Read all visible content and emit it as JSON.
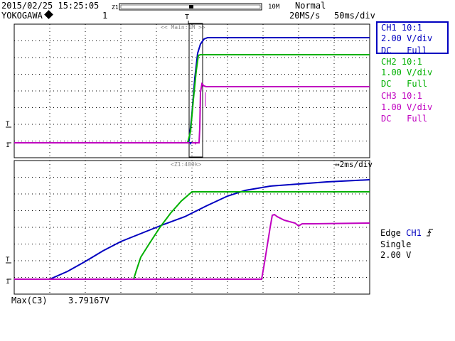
{
  "header": {
    "datetime": "2015/02/25 15:25:05",
    "zoom_left": "Z1",
    "brand": "YOKOGAWA",
    "record_number": "1",
    "memory_length": "10M",
    "trigger_mode": "Normal",
    "sample_rate": "20MS/s",
    "time_per_div_main": "50ms/div"
  },
  "main_window": {
    "label": "<< Main:1M >>"
  },
  "zoom_window": {
    "label": "<Z1:400k>",
    "time_per_div": "↔2ms/div"
  },
  "channels": [
    {
      "name": "CH1",
      "probe": "10:1",
      "vdiv": "2.00 V/div",
      "coupling": "DC",
      "bandwidth": "Full",
      "color": "#0000c0"
    },
    {
      "name": "CH2",
      "probe": "10:1",
      "vdiv": "1.00 V/div",
      "coupling": "DC",
      "bandwidth": "Full",
      "color": "#00b000"
    },
    {
      "name": "CH3",
      "probe": "10:1",
      "vdiv": "1.00 V/div",
      "coupling": "DC",
      "bandwidth": "Full",
      "color": "#c000c0"
    }
  ],
  "trigger": {
    "type": "Edge",
    "source": "CH1",
    "edge_icon": "rising-edge-icon",
    "mode": "Single",
    "level": "2.00 V"
  },
  "measurement": {
    "label": "Max(C3)",
    "value": "3.79167V"
  },
  "marker_labels": {
    "ch1": "1",
    "ch2": "2",
    "ch3": "3",
    "trigger": "T"
  },
  "colors": {
    "grid": "#000000",
    "ch1": "#0000c0",
    "ch2": "#00b000",
    "ch3": "#c000c0",
    "background": "#ffffff"
  }
}
